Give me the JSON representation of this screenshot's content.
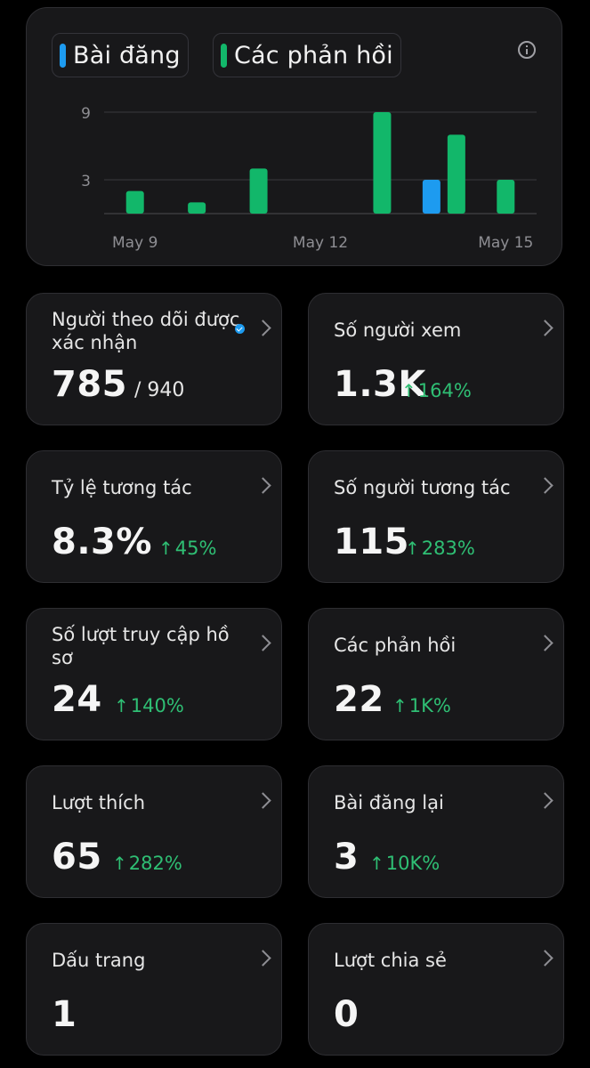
{
  "colors": {
    "posts": "#1d9bf0",
    "replies": "#12b76a",
    "up": "#2fbf74"
  },
  "legend": {
    "posts": "Bài đăng",
    "replies": "Các phản hồi"
  },
  "chart_data": {
    "type": "bar",
    "x": [
      "May 9",
      "May 10",
      "May 11",
      "May 12",
      "May 13",
      "May 14",
      "May 15"
    ],
    "x_tick_labels": [
      "May 9",
      "May 12",
      "May 15"
    ],
    "y_ticks": [
      3,
      9
    ],
    "ylim": [
      0,
      10
    ],
    "series": [
      {
        "name": "Bài đăng",
        "values": [
          0,
          0,
          0,
          0,
          0,
          3,
          0
        ]
      },
      {
        "name": "Các phản hồi",
        "values": [
          2,
          1,
          4,
          0,
          9,
          7,
          3
        ]
      }
    ],
    "grid": true
  },
  "metrics": [
    {
      "label": "Người theo dõi được xác nhận",
      "value": "785",
      "total": "/ 940",
      "verified": true
    },
    {
      "label": "Số người xem",
      "value": "1.3K",
      "arrow": "↑",
      "delta": "164%"
    },
    {
      "label": "Tỷ lệ tương tác",
      "value": "8.3%",
      "arrow": "↑",
      "delta": "45%"
    },
    {
      "label": "Số người tương tác",
      "value": "115",
      "arrow": "↑",
      "delta": "283%"
    },
    {
      "label": "Số lượt truy cập hồ sơ",
      "value": "24",
      "arrow": "↑",
      "delta": "140%"
    },
    {
      "label": "Các phản hồi",
      "value": "22",
      "arrow": "↑",
      "delta": "1K%"
    },
    {
      "label": "Lượt thích",
      "value": "65",
      "arrow": "↑",
      "delta": "282%"
    },
    {
      "label": "Bài đăng lại",
      "value": "3",
      "arrow": "↑",
      "delta": "10K%"
    },
    {
      "label": "Dấu trang",
      "value": "1"
    },
    {
      "label": "Lượt chia sẻ",
      "value": "0"
    }
  ]
}
